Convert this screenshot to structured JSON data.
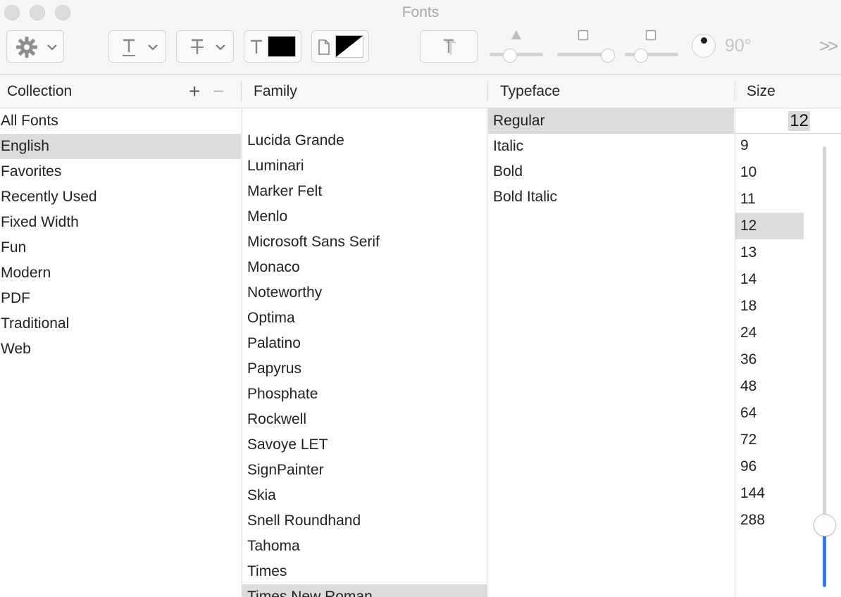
{
  "window": {
    "title": "Fonts",
    "traffic_lights": [
      "close-button",
      "minimize-button",
      "zoom-button"
    ]
  },
  "toolbar": {
    "actions_icon": "gear-icon",
    "underline_icon": "underline-icon",
    "strikethrough_icon": "strikethrough-icon",
    "text_color_icon": "text-color-icon",
    "text_color": "#000000",
    "document_color_icon": "document-color-icon",
    "text_shadow_icon": "text-shadow-icon",
    "shadow_opacity_slider_level": 0.38,
    "shadow_blur_slider_level": 0.95,
    "shadow_offset_slider_level": 0.3,
    "rotation_label": "90°",
    "overflow_label": ">>"
  },
  "columns": {
    "collection": "Collection",
    "family": "Family",
    "typeface": "Typeface",
    "size": "Size"
  },
  "collections": {
    "items": [
      "All Fonts",
      "English",
      "Favorites",
      "Recently Used",
      "Fixed Width",
      "Fun",
      "Modern",
      "PDF",
      "Traditional",
      "Web"
    ],
    "selected": "English",
    "add_icon": "plus-icon",
    "remove_icon": "minus-icon"
  },
  "families": {
    "items": [
      "Lucida Grande",
      "Luminari",
      "Marker Felt",
      "Menlo",
      "Microsoft Sans Serif",
      "Monaco",
      "Noteworthy",
      "Optima",
      "Palatino",
      "Papyrus",
      "Phosphate",
      "Rockwell",
      "Savoye LET",
      "SignPainter",
      "Skia",
      "Snell Roundhand",
      "Tahoma",
      "Times",
      "Times New Roman"
    ],
    "selected": "Times New Roman"
  },
  "typefaces": {
    "items": [
      "Regular",
      "Italic",
      "Bold",
      "Bold Italic"
    ],
    "selected": "Regular"
  },
  "sizes": {
    "current_value": "12",
    "items": [
      "9",
      "10",
      "11",
      "12",
      "13",
      "14",
      "18",
      "24",
      "36",
      "48",
      "64",
      "72",
      "96",
      "144",
      "288"
    ],
    "selected": "12",
    "slider_level": 0.14
  },
  "colors": {
    "selection": "#dcdcdc",
    "accent": "#3478f6"
  }
}
